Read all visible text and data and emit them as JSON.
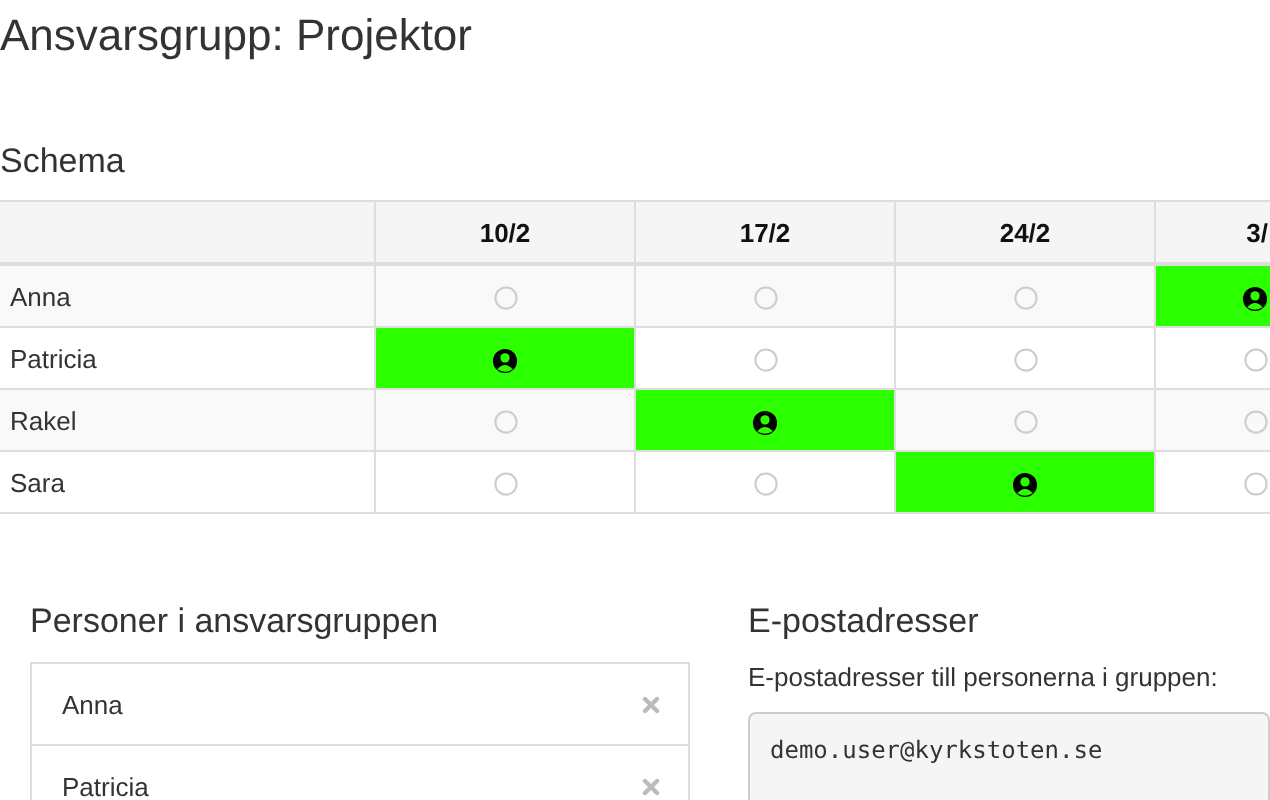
{
  "title": "Ansvarsgrupp: Projektor",
  "schedule": {
    "heading": "Schema",
    "dates": [
      "10/2",
      "17/2",
      "24/2",
      "3/"
    ],
    "rows": [
      {
        "name": "Anna",
        "slots": [
          {
            "assigned": false
          },
          {
            "assigned": false
          },
          {
            "assigned": false
          },
          {
            "assigned": true
          }
        ]
      },
      {
        "name": "Patricia",
        "slots": [
          {
            "assigned": true
          },
          {
            "assigned": false
          },
          {
            "assigned": false
          },
          {
            "assigned": false
          }
        ]
      },
      {
        "name": "Rakel",
        "slots": [
          {
            "assigned": false
          },
          {
            "assigned": true
          },
          {
            "assigned": false
          },
          {
            "assigned": false
          }
        ]
      },
      {
        "name": "Sara",
        "slots": [
          {
            "assigned": false
          },
          {
            "assigned": false
          },
          {
            "assigned": true
          },
          {
            "assigned": false
          }
        ]
      }
    ]
  },
  "members": {
    "heading": "Personer i ansvarsgruppen",
    "items": [
      "Anna",
      "Patricia"
    ]
  },
  "emails": {
    "heading": "E-postadresser",
    "description": "E-postadresser till personerna i gruppen:",
    "addresses": "demo.user@kyrkstoten.se"
  }
}
